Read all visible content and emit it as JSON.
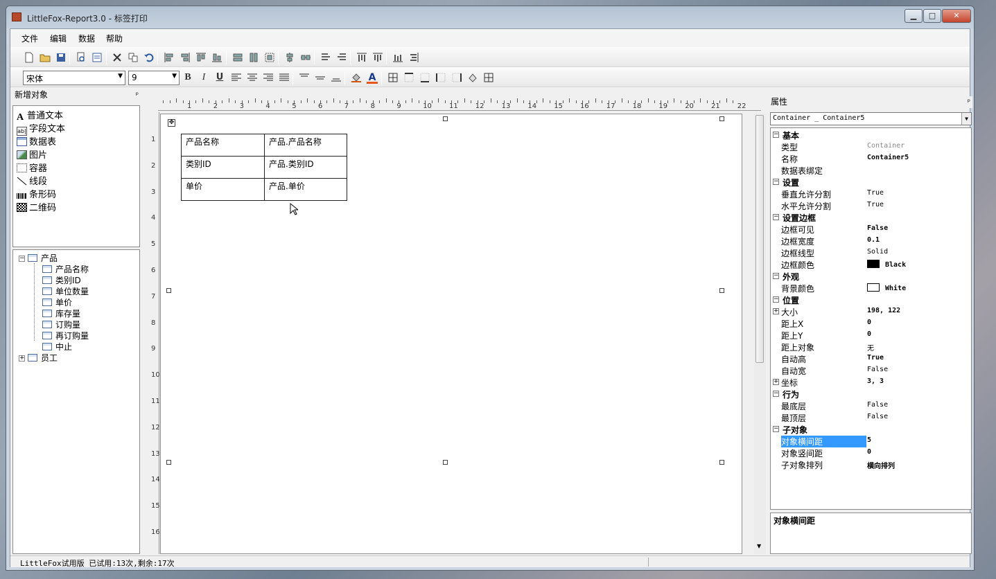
{
  "window": {
    "title": "LittleFox-Report3.0 - 标签打印",
    "buttons": {
      "minimize": "▁",
      "maximize": "□",
      "close": "✕"
    }
  },
  "menu": [
    "文件",
    "编辑",
    "数据",
    "帮助"
  ],
  "format_bar": {
    "font": "宋体",
    "size": "9",
    "bold": "B",
    "italic": "I",
    "underline": "U",
    "fontcolor": "A"
  },
  "left_panel": {
    "title": "新增对象",
    "pin": "ᵖ",
    "tools": [
      "普通文本",
      "字段文本",
      "数据表",
      "图片",
      "容器",
      "线段",
      "条形码",
      "二维码"
    ]
  },
  "tree": {
    "root1": "产品",
    "children": [
      "产品名称",
      "类别ID",
      "单位数量",
      "单价",
      "库存量",
      "订购量",
      "再订购量",
      "中止"
    ],
    "root2": "员工",
    "expand_minus": "−",
    "expand_plus": "+"
  },
  "ruler": {
    "h": [
      "1",
      "2",
      "3",
      "4",
      "5",
      "6",
      "7",
      "8",
      "9",
      "10",
      "11",
      "12",
      "13",
      "14",
      "15",
      "16",
      "17",
      "18",
      "19",
      "20",
      "21",
      "22"
    ],
    "v": [
      "1",
      "2",
      "3",
      "4",
      "5",
      "6",
      "7",
      "8",
      "9",
      "10",
      "11",
      "12",
      "13",
      "14",
      "15",
      "16"
    ]
  },
  "table_cells": [
    [
      "产品名称",
      "产品.产品名称"
    ],
    [
      "类别ID",
      "产品.类别ID"
    ],
    [
      "单价",
      "产品.单价"
    ]
  ],
  "properties": {
    "title": "属性",
    "pin": "ᵖ",
    "combo": "Container _ Container5",
    "sections": [
      {
        "cat": "基本",
        "rows": [
          [
            "类型",
            "Container",
            "g"
          ],
          [
            "名称",
            "Container5",
            "b"
          ],
          [
            "数据表绑定",
            "",
            ""
          ]
        ]
      },
      {
        "cat": "设置",
        "rows": [
          [
            "垂直允许分割",
            "True",
            ""
          ],
          [
            "水平允许分割",
            "True",
            ""
          ]
        ]
      },
      {
        "cat": "设置边框",
        "rows": [
          [
            "边框可见",
            "False",
            "b"
          ],
          [
            "边框宽度",
            "0.1",
            "b"
          ],
          [
            "边框线型",
            "Solid",
            ""
          ],
          [
            "边框颜色",
            "Black",
            "b"
          ]
        ]
      },
      {
        "cat": "外观",
        "rows": [
          [
            "背景颜色",
            "White",
            "b"
          ]
        ]
      },
      {
        "cat": "位置",
        "rows": [
          [
            "大小",
            "198, 122",
            "b"
          ],
          [
            "距上X",
            "0",
            "b"
          ],
          [
            "距上Y",
            "0",
            "b"
          ],
          [
            "距上对象",
            "无",
            ""
          ],
          [
            "自动高",
            "True",
            "b"
          ],
          [
            "自动宽",
            "False",
            ""
          ],
          [
            "坐标",
            "3, 3",
            "b"
          ]
        ]
      },
      {
        "cat": "行为",
        "rows": [
          [
            "最底层",
            "False",
            ""
          ],
          [
            "最顶层",
            "False",
            ""
          ]
        ]
      },
      {
        "cat": "子对象",
        "rows": [
          [
            "对象横间距",
            "5",
            "b"
          ],
          [
            "对象竖间距",
            "0",
            "b"
          ],
          [
            "子对象排列",
            "横向排列",
            "b"
          ]
        ]
      }
    ],
    "description": "对象横间距"
  },
  "status": {
    "text": "LittleFox试用版 已试用:13次,剩余:17次"
  },
  "colors": {
    "black_swatch": "#000000",
    "white_swatch": "#ffffff",
    "selection": "#3399ff"
  }
}
